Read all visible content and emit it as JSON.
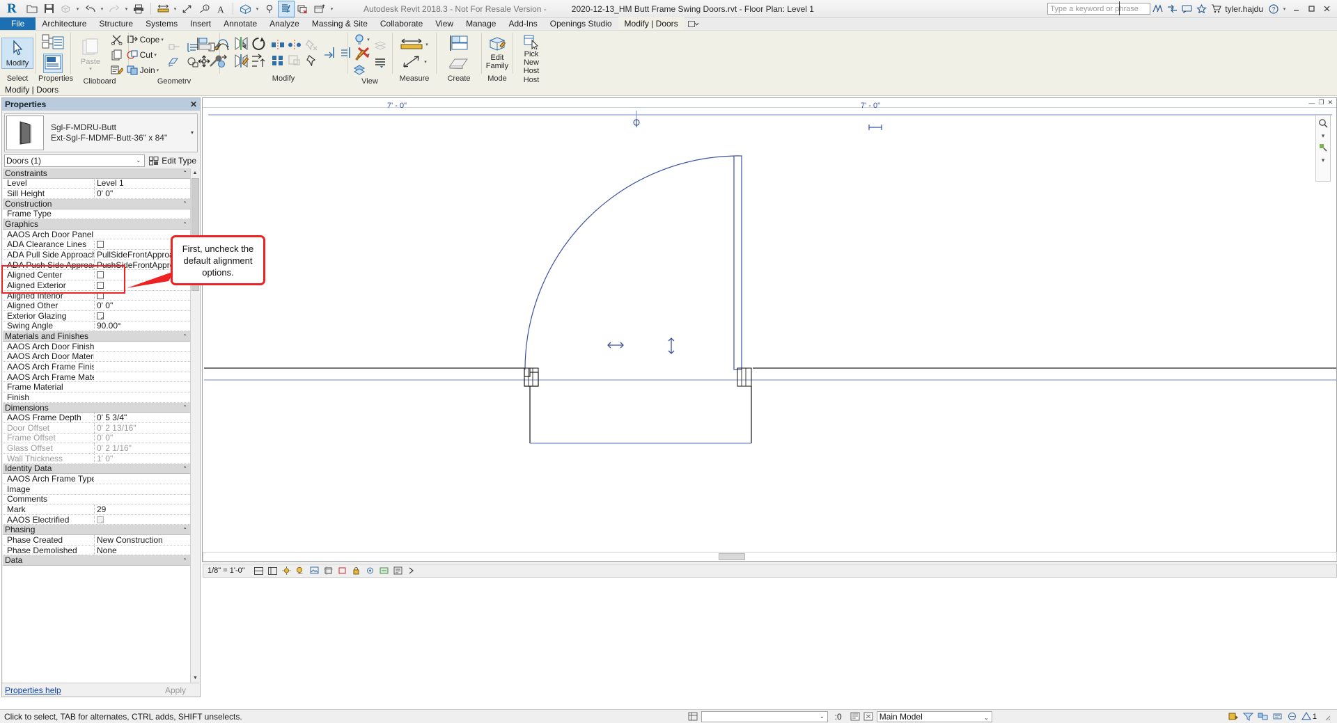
{
  "titlebar": {
    "app_title": "Autodesk Revit 2018.3 - Not For Resale Version -",
    "document_title": "2020-12-13_HM Butt Frame Swing Doors.rvt - Floor Plan: Level 1",
    "search_placeholder": "Type a keyword or phrase",
    "user": "tyler.hajdu",
    "qat": [
      {
        "name": "open-icon",
        "label": "Open"
      },
      {
        "name": "save-icon",
        "label": "Save"
      },
      {
        "name": "save-as-icon",
        "label": "Save As"
      },
      {
        "name": "undo-icon",
        "label": "Undo"
      },
      {
        "name": "redo-icon",
        "label": "Redo"
      },
      {
        "name": "print-icon",
        "label": "Print"
      },
      {
        "name": "measure-icon",
        "label": "Measure"
      },
      {
        "name": "aligned-dimension-icon",
        "label": "Aligned Dimension"
      },
      {
        "name": "tag-icon",
        "label": "Tag"
      },
      {
        "name": "text-icon",
        "label": "Text"
      },
      {
        "name": "default-3d-view-icon",
        "label": "Default 3D View"
      },
      {
        "name": "section-icon",
        "label": "Section"
      },
      {
        "name": "thin-lines-icon",
        "label": "Thin Lines"
      },
      {
        "name": "close-hidden-windows-icon",
        "label": "Close Hidden Windows"
      },
      {
        "name": "switch-windows-icon",
        "label": "Switch Windows"
      }
    ],
    "right_icons": [
      {
        "name": "autodesk-account-icon"
      },
      {
        "name": "exchange-apps-icon"
      },
      {
        "name": "communication-center-icon"
      },
      {
        "name": "favorites-star-icon"
      },
      {
        "name": "shopping-cart-icon"
      },
      {
        "name": "help-icon"
      }
    ],
    "window_buttons": [
      "minimize",
      "restore",
      "close"
    ]
  },
  "ribbon": {
    "tabs": [
      {
        "label": "File",
        "state": "file"
      },
      {
        "label": "Architecture",
        "state": "normal"
      },
      {
        "label": "Structure",
        "state": "normal"
      },
      {
        "label": "Systems",
        "state": "normal"
      },
      {
        "label": "Insert",
        "state": "normal"
      },
      {
        "label": "Annotate",
        "state": "normal"
      },
      {
        "label": "Analyze",
        "state": "normal"
      },
      {
        "label": "Massing & Site",
        "state": "normal"
      },
      {
        "label": "Collaborate",
        "state": "normal"
      },
      {
        "label": "View",
        "state": "normal"
      },
      {
        "label": "Manage",
        "state": "normal"
      },
      {
        "label": "Add-Ins",
        "state": "normal"
      },
      {
        "label": "Openings Studio",
        "state": "normal"
      },
      {
        "label": "Modify | Doors",
        "state": "active"
      }
    ],
    "panels": [
      {
        "label": "Select",
        "name": "panel-select"
      },
      {
        "label": "Properties",
        "name": "panel-properties"
      },
      {
        "label": "Clipboard",
        "name": "panel-clipboard"
      },
      {
        "label": "Geometry",
        "name": "panel-geometry"
      },
      {
        "label": "Modify",
        "name": "panel-modify"
      },
      {
        "label": "View",
        "name": "panel-view"
      },
      {
        "label": "Measure",
        "name": "panel-measure"
      },
      {
        "label": "Create",
        "name": "panel-create"
      },
      {
        "label": "Mode",
        "name": "panel-mode"
      },
      {
        "label": "Host",
        "name": "panel-host"
      }
    ],
    "buttons": {
      "modify": "Modify",
      "paste": "Paste",
      "cope": "Cope",
      "cut": "Cut",
      "join": "Join",
      "edit_family": "Edit\nFamily",
      "pick_new_host": "Pick\nNew Host"
    },
    "context_bar": "Modify | Doors"
  },
  "properties": {
    "panel_title": "Properties",
    "close_label": "✕",
    "type_name_line1": "Sgl-F-MDRU-Butt",
    "type_name_line2": "Ext-Sgl-F-MDMF-Butt-36\" x 84\"",
    "selector_value": "Doors (1)",
    "edit_type_label": "Edit Type",
    "help_link": "Properties help",
    "apply_label": "Apply",
    "rows": [
      {
        "type": "group",
        "name": "Constraints"
      },
      {
        "type": "row",
        "name": "Level",
        "value": "Level 1",
        "kind": "text"
      },
      {
        "type": "row",
        "name": "Sill Height",
        "value": "0'  0\"",
        "kind": "text"
      },
      {
        "type": "group",
        "name": "Construction"
      },
      {
        "type": "row",
        "name": "Frame Type",
        "value": "",
        "kind": "text"
      },
      {
        "type": "group",
        "name": "Graphics"
      },
      {
        "type": "row",
        "name": "AAOS Arch Door Panel Type",
        "value": "",
        "kind": "text"
      },
      {
        "type": "row",
        "name": "ADA Clearance Lines",
        "value": "",
        "kind": "checkbox",
        "checked": false
      },
      {
        "type": "row",
        "name": "ADA Pull Side Approach<...",
        "value": "PullSideFrontApproach",
        "kind": "text"
      },
      {
        "type": "row",
        "name": "ADA Push Side Approach...",
        "value": "PushSideFrontApproach",
        "kind": "text"
      },
      {
        "type": "row",
        "name": "Aligned Center",
        "value": "",
        "kind": "checkbox",
        "checked": false,
        "highlight": true
      },
      {
        "type": "row",
        "name": "Aligned Exterior",
        "value": "",
        "kind": "checkbox",
        "checked": false,
        "highlight": true
      },
      {
        "type": "row",
        "name": "Aligned Interior",
        "value": "",
        "kind": "checkbox",
        "checked": false,
        "highlight": true
      },
      {
        "type": "row",
        "name": "Aligned Other",
        "value": "0'  0\"",
        "kind": "text"
      },
      {
        "type": "row",
        "name": "Exterior Glazing",
        "value": "",
        "kind": "checkbox",
        "checked": true
      },
      {
        "type": "row",
        "name": "Swing Angle",
        "value": "90.00°",
        "kind": "text"
      },
      {
        "type": "group",
        "name": "Materials and Finishes"
      },
      {
        "type": "row",
        "name": "AAOS Arch Door Finish",
        "value": "",
        "kind": "text"
      },
      {
        "type": "row",
        "name": "AAOS Arch Door Material ...",
        "value": "",
        "kind": "text"
      },
      {
        "type": "row",
        "name": "AAOS Arch Frame Finish",
        "value": "",
        "kind": "text"
      },
      {
        "type": "row",
        "name": "AAOS Arch Frame Materia...",
        "value": "",
        "kind": "text"
      },
      {
        "type": "row",
        "name": "Frame Material",
        "value": "",
        "kind": "text"
      },
      {
        "type": "row",
        "name": "Finish",
        "value": "",
        "kind": "text"
      },
      {
        "type": "group",
        "name": "Dimensions"
      },
      {
        "type": "row",
        "name": "AAOS Frame Depth",
        "value": "0'  5 3/4\"",
        "kind": "text"
      },
      {
        "type": "row",
        "name": "Door Offset",
        "value": "0'  2 13/16\"",
        "kind": "text",
        "dim": true
      },
      {
        "type": "row",
        "name": "Frame Offset",
        "value": "0'  0\"",
        "kind": "text",
        "dim": true
      },
      {
        "type": "row",
        "name": "Glass Offset",
        "value": "0'  2 1/16\"",
        "kind": "text",
        "dim": true
      },
      {
        "type": "row",
        "name": "Wall Thickness",
        "value": "1'  0\"",
        "kind": "text",
        "dim": true
      },
      {
        "type": "group",
        "name": "Identity Data"
      },
      {
        "type": "row",
        "name": "AAOS Arch Frame Type",
        "value": "",
        "kind": "text"
      },
      {
        "type": "row",
        "name": "Image",
        "value": "",
        "kind": "text"
      },
      {
        "type": "row",
        "name": "Comments",
        "value": "",
        "kind": "text"
      },
      {
        "type": "row",
        "name": "Mark",
        "value": "29",
        "kind": "text"
      },
      {
        "type": "row",
        "name": "AAOS Electrified",
        "value": "",
        "kind": "checkbox",
        "checked": true,
        "disabled": true
      },
      {
        "type": "group",
        "name": "Phasing"
      },
      {
        "type": "row",
        "name": "Phase Created",
        "value": "New Construction",
        "kind": "text"
      },
      {
        "type": "row",
        "name": "Phase Demolished",
        "value": "None",
        "kind": "text"
      },
      {
        "type": "group",
        "name": "Data"
      }
    ]
  },
  "annotation": {
    "callout_text": "First, uncheck the default alignment options.",
    "callout_color": "#ee2222"
  },
  "canvas": {
    "dim_left": "7' - 0\"",
    "dim_right": "7' - 0\"",
    "swing_angle_marker": "90°",
    "door_symbols": [
      "flip-horizontal-arrow",
      "flip-vertical-arrow"
    ]
  },
  "view_control_bar": {
    "scale": "1/8\" = 1'-0\"",
    "icons": [
      {
        "name": "detail-level-icon"
      },
      {
        "name": "visual-style-icon"
      },
      {
        "name": "sun-path-icon"
      },
      {
        "name": "shadows-icon"
      },
      {
        "name": "rendering-dialog-icon"
      },
      {
        "name": "crop-view-icon"
      },
      {
        "name": "show-crop-region-icon"
      },
      {
        "name": "lock-3d-view-icon"
      },
      {
        "name": "temporary-hide-isolate-icon"
      },
      {
        "name": "reveal-hidden-elements-icon"
      },
      {
        "name": "temporary-view-properties-icon"
      },
      {
        "name": "hide-analytical-model-icon"
      },
      {
        "name": "reveal-constraints-icon"
      }
    ]
  },
  "statusbar": {
    "message": "Click to select, TAB for alternates, CTRL adds, SHIFT unselects.",
    "filter_count": ":0",
    "worksets_value": "",
    "model_value": "Main Model",
    "right_icons": [
      {
        "name": "design-options-icon"
      },
      {
        "name": "exclude-options-icon"
      },
      {
        "name": "editable-only-icon"
      },
      {
        "name": "filter-icon"
      },
      {
        "name": "warnings-icon"
      },
      {
        "name": "warning-count-icon"
      }
    ],
    "warning_count": "1"
  }
}
